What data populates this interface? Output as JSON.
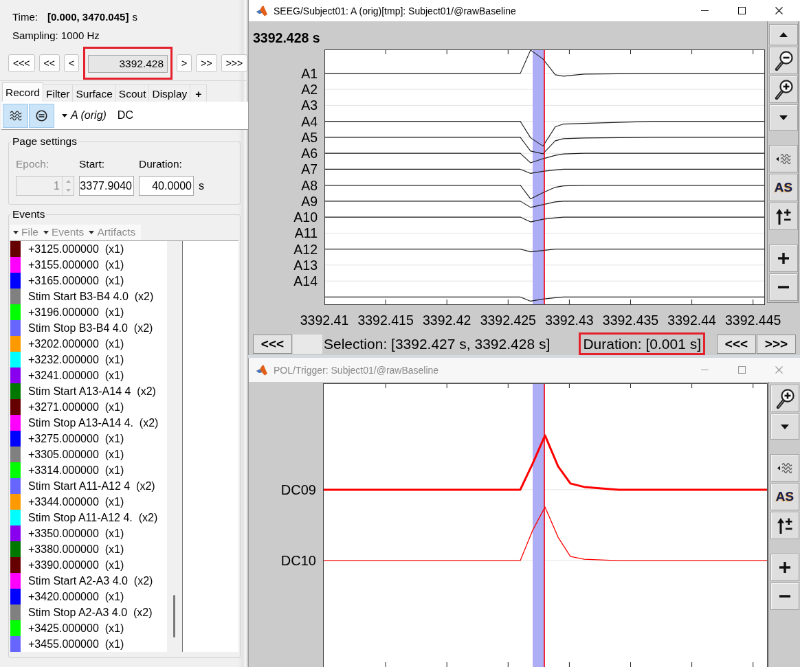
{
  "left_panel": {
    "time": {
      "label": "Time:",
      "value": "[0.000, 3470.045]",
      "unit": "s"
    },
    "sampling": "Sampling: 1000 Hz",
    "navigation": {
      "back_buttons": [
        "<<<",
        "<<",
        "<"
      ],
      "current_time": {
        "value": "3392.428",
        "highlighted": true
      },
      "forward_buttons": [
        ">",
        ">>",
        ">>>"
      ]
    },
    "tabs": [
      {
        "label": "Record",
        "kind": "tab",
        "selected": true
      },
      {
        "label": "Filter",
        "kind": "tab",
        "selected": false
      },
      {
        "label": "Surface",
        "kind": "tab",
        "selected": false
      },
      {
        "label": "Scout",
        "kind": "tab",
        "selected": false
      },
      {
        "label": "Display",
        "kind": "tab",
        "selected": false
      },
      {
        "label": "+",
        "kind": "add",
        "selected": false
      }
    ],
    "toolbar": {
      "toggles": [
        {
          "kind": "waves",
          "selected": true
        },
        {
          "kind": "circle",
          "selected": true
        }
      ],
      "montage": "A (orig)",
      "mode": "DC"
    },
    "page_settings": {
      "title": "Page settings",
      "epoch": {
        "label": "Epoch:",
        "value": "1",
        "disabled": true
      },
      "start": {
        "label": "Start:",
        "value": "3377.9040"
      },
      "duration": {
        "label": "Duration:",
        "value": "40.0000",
        "unit": "s"
      }
    },
    "events": {
      "title": "Events",
      "menus": [
        {
          "label": "File",
          "disabled": true
        },
        {
          "label": "Events",
          "disabled": true
        },
        {
          "label": "Artifacts",
          "disabled": true
        }
      ],
      "items": [
        {
          "label": "+3125.000000  (x1)",
          "color": "#660000"
        },
        {
          "label": "+3155.000000  (x1)",
          "color": "#ff00ff"
        },
        {
          "label": "+3165.000000  (x1)",
          "color": "#0000ff"
        },
        {
          "label": "Stim Start B3-B4 4.0  (x2)",
          "color": "#808080"
        },
        {
          "label": "+3196.000000  (x1)",
          "color": "#00ff00"
        },
        {
          "label": "Stim Stop B3-B4 4.0  (x2)",
          "color": "#6666ff"
        },
        {
          "label": "+3202.000000  (x1)",
          "color": "#ff9900"
        },
        {
          "label": "+3232.000000  (x1)",
          "color": "#00ffff"
        },
        {
          "label": "+3241.000000  (x1)",
          "color": "#8800ee"
        },
        {
          "label": "Stim Start A13-A14 4  (x2)",
          "color": "#007800"
        },
        {
          "label": "+3271.000000  (x1)",
          "color": "#660000"
        },
        {
          "label": "Stim Stop A13-A14 4.  (x2)",
          "color": "#ff00ff"
        },
        {
          "label": "+3275.000000  (x1)",
          "color": "#0000ff"
        },
        {
          "label": "+3305.000000  (x1)",
          "color": "#808080"
        },
        {
          "label": "+3314.000000  (x1)",
          "color": "#00ff00"
        },
        {
          "label": "Stim Start A11-A12 4  (x2)",
          "color": "#6666ff"
        },
        {
          "label": "+3344.000000  (x1)",
          "color": "#ff9900"
        },
        {
          "label": "Stim Stop A11-A12 4.  (x2)",
          "color": "#00ffff"
        },
        {
          "label": "+3350.000000  (x1)",
          "color": "#8800ee"
        },
        {
          "label": "+3380.000000  (x1)",
          "color": "#007800"
        },
        {
          "label": "+3390.000000  (x1)",
          "color": "#660000"
        },
        {
          "label": "Stim Start A2-A3 4.0  (x2)",
          "color": "#ff00ff"
        },
        {
          "label": "+3420.000000  (x1)",
          "color": "#0000ff"
        },
        {
          "label": "Stim Stop A2-A3 4.0  (x2)",
          "color": "#808080"
        },
        {
          "label": "+3425.000000  (x1)",
          "color": "#00ff00"
        },
        {
          "label": "+3455.000000  (x1)",
          "color": "#6666ff"
        }
      ]
    }
  },
  "top_window": {
    "title": "SEEG/Subject01: A (orig)[tmp]: Subject01/@rawBaseline",
    "active": true,
    "time_label": "3392.428 s",
    "channels": [
      "A1",
      "A2",
      "A3",
      "A4",
      "A5",
      "A6",
      "A7",
      "A8",
      "A9",
      "A10",
      "A11",
      "A12",
      "A13",
      "A14"
    ],
    "x_ticks": [
      "3392.41",
      "3392.415",
      "3392.42",
      "3392.425",
      "3392.43",
      "3392.435",
      "3392.44",
      "3392.445"
    ],
    "bottom_bar": {
      "back_button": "<<<",
      "selection": "Selection: [3392.427 s, 3392.428 s]",
      "duration": {
        "text": "Duration: [0.001 s]",
        "highlighted": true
      },
      "page_buttons": [
        "<<<",
        ">>>"
      ]
    },
    "toolbar": [
      {
        "buttons": [
          {
            "kind": "scroll-up"
          },
          {
            "kind": "zoom-out"
          },
          {
            "kind": "zoom-in"
          },
          {
            "kind": "scroll-down"
          }
        ]
      },
      {
        "buttons": [
          {
            "kind": "waves"
          },
          {
            "kind": "text",
            "label": "AS"
          },
          {
            "kind": "amplitude"
          }
        ]
      },
      {
        "buttons": [
          {
            "kind": "plus"
          },
          {
            "kind": "minus"
          }
        ]
      }
    ]
  },
  "bottom_window": {
    "title": "POL/Trigger: Subject01/@rawBaseline",
    "active": false,
    "channels": [
      "DC09",
      "DC10"
    ],
    "toolbar": [
      {
        "buttons": [
          {
            "kind": "zoom-in"
          },
          {
            "kind": "scroll-down"
          }
        ]
      },
      {
        "buttons": [
          {
            "kind": "waves"
          },
          {
            "kind": "text",
            "label": "AS"
          },
          {
            "kind": "amplitude"
          }
        ]
      },
      {
        "buttons": [
          {
            "kind": "plus"
          },
          {
            "kind": "minus"
          }
        ]
      }
    ]
  }
}
